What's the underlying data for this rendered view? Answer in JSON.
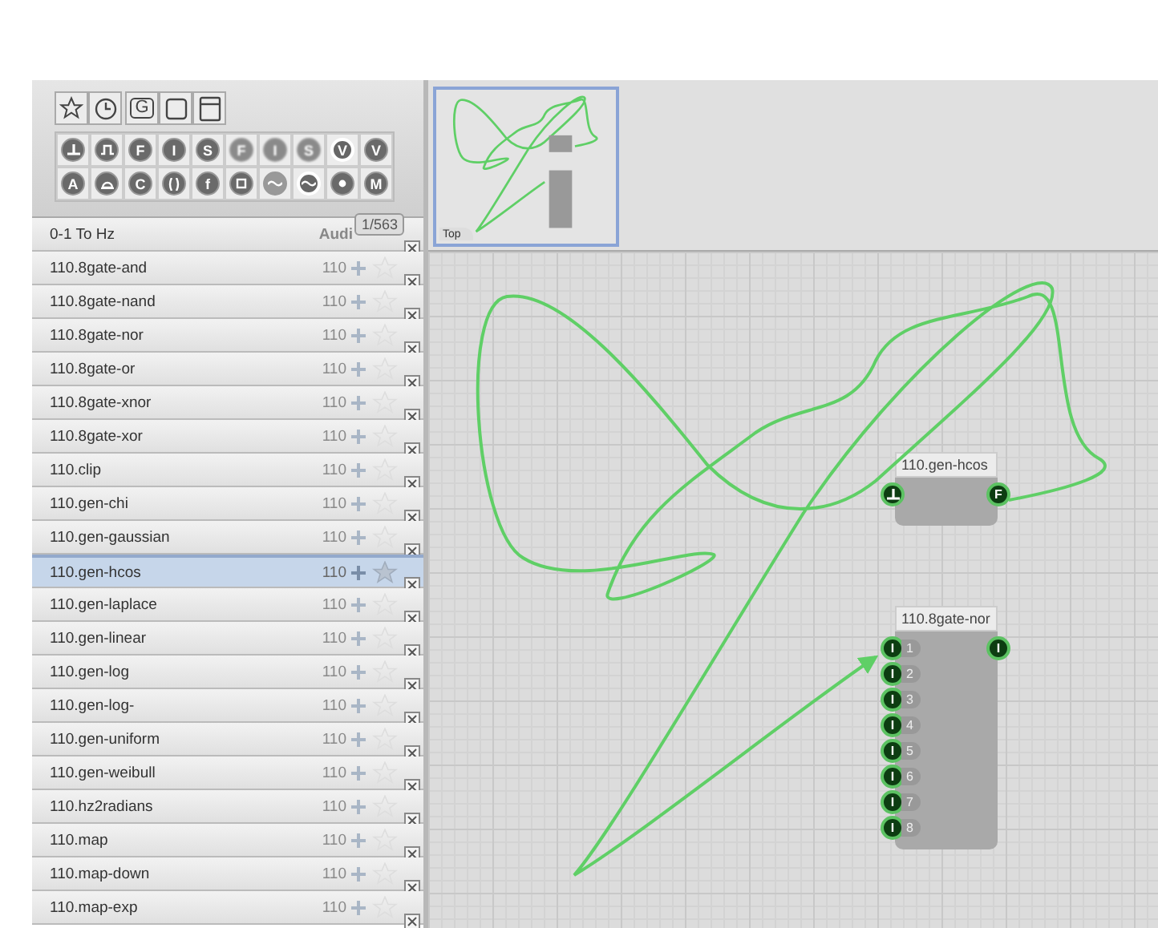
{
  "toolbar": {
    "top_buttons": [
      {
        "kind": "star"
      },
      {
        "kind": "clock"
      },
      {
        "kind": "letter",
        "glyph": "G"
      },
      {
        "kind": "square"
      },
      {
        "kind": "window"
      }
    ],
    "type_rows": [
      [
        {
          "kind": "ground"
        },
        {
          "kind": "pulse"
        },
        {
          "kind": "letter",
          "glyph": "F"
        },
        {
          "kind": "letter",
          "glyph": "I"
        },
        {
          "kind": "letter",
          "glyph": "S"
        },
        {
          "kind": "letter",
          "glyph": "F"
        },
        {
          "kind": "letter",
          "glyph": "I"
        },
        {
          "kind": "letter",
          "glyph": "S"
        },
        {
          "kind": "letter",
          "glyph": "V"
        },
        {
          "kind": "letter",
          "glyph": "V"
        }
      ],
      [
        {
          "kind": "letter",
          "glyph": "A"
        },
        {
          "kind": "dome"
        },
        {
          "kind": "letter",
          "glyph": "C"
        },
        {
          "kind": "brackets"
        },
        {
          "kind": "letter",
          "glyph": "f"
        },
        {
          "kind": "box"
        },
        {
          "kind": "wave"
        },
        {
          "kind": "wave"
        },
        {
          "kind": "dot"
        },
        {
          "kind": "letter",
          "glyph": "M"
        }
      ]
    ]
  },
  "list_header": {
    "name": "0-1 To Hz",
    "category": "Audi",
    "tooltip": "1/563"
  },
  "list": [
    {
      "name": "110.8gate-and",
      "version": "110",
      "selected": false
    },
    {
      "name": "110.8gate-nand",
      "version": "110",
      "selected": false
    },
    {
      "name": "110.8gate-nor",
      "version": "110",
      "selected": false
    },
    {
      "name": "110.8gate-or",
      "version": "110",
      "selected": false
    },
    {
      "name": "110.8gate-xnor",
      "version": "110",
      "selected": false
    },
    {
      "name": "110.8gate-xor",
      "version": "110",
      "selected": false
    },
    {
      "name": "110.clip",
      "version": "110",
      "selected": false
    },
    {
      "name": "110.gen-chi",
      "version": "110",
      "selected": false
    },
    {
      "name": "110.gen-gaussian",
      "version": "110",
      "selected": false
    },
    {
      "name": "110.gen-hcos",
      "version": "110",
      "selected": true
    },
    {
      "name": "110.gen-laplace",
      "version": "110",
      "selected": false
    },
    {
      "name": "110.gen-linear",
      "version": "110",
      "selected": false
    },
    {
      "name": "110.gen-log",
      "version": "110",
      "selected": false
    },
    {
      "name": "110.gen-log-",
      "version": "110",
      "selected": false
    },
    {
      "name": "110.gen-uniform",
      "version": "110",
      "selected": false
    },
    {
      "name": "110.gen-weibull",
      "version": "110",
      "selected": false
    },
    {
      "name": "110.hz2radians",
      "version": "110",
      "selected": false
    },
    {
      "name": "110.map",
      "version": "110",
      "selected": false
    },
    {
      "name": "110.map-down",
      "version": "110",
      "selected": false
    },
    {
      "name": "110.map-exp",
      "version": "110",
      "selected": false
    }
  ],
  "thumbnail": {
    "label": "Top",
    "selected": true
  },
  "nodes": [
    {
      "title": "110.gen-hcos",
      "inputs": [
        {
          "kind": "ground"
        }
      ],
      "outputs": [
        {
          "kind": "letter",
          "glyph": "F"
        }
      ]
    },
    {
      "title": "110.8gate-nor",
      "inputs": [
        {
          "kind": "letter",
          "glyph": "I",
          "label": "1"
        },
        {
          "kind": "letter",
          "glyph": "I",
          "label": "2"
        },
        {
          "kind": "letter",
          "glyph": "I",
          "label": "3"
        },
        {
          "kind": "letter",
          "glyph": "I",
          "label": "4"
        },
        {
          "kind": "letter",
          "glyph": "I",
          "label": "5"
        },
        {
          "kind": "letter",
          "glyph": "I",
          "label": "6"
        },
        {
          "kind": "letter",
          "glyph": "I",
          "label": "7"
        },
        {
          "kind": "letter",
          "glyph": "I",
          "label": "8"
        }
      ],
      "outputs": [
        {
          "kind": "letter",
          "glyph": "I"
        }
      ]
    }
  ]
}
